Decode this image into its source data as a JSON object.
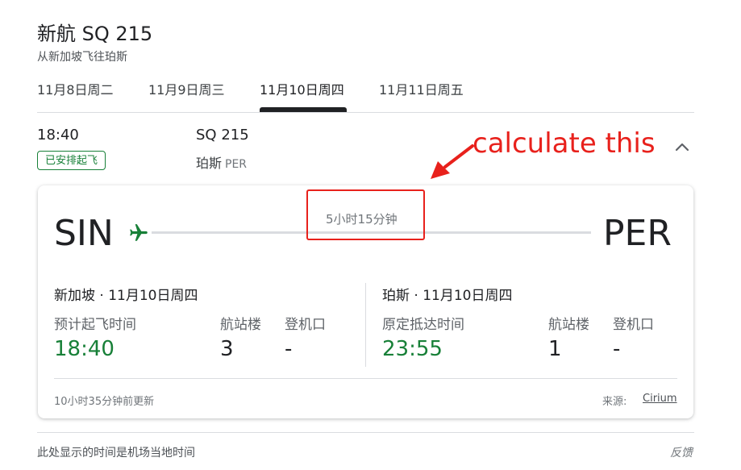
{
  "header": {
    "title": "新航 SQ 215",
    "subtitle": "从新加坡飞往珀斯"
  },
  "tabs": [
    {
      "label": "11月8日周二"
    },
    {
      "label": "11月9日周三"
    },
    {
      "label": "11月10日周四",
      "selected": true
    },
    {
      "label": "11月11日周五"
    }
  ],
  "summary": {
    "departure_time": "18:40",
    "status": "已安排起飞",
    "flight_number": "SQ 215",
    "destination_name": "珀斯",
    "destination_code": "PER"
  },
  "annotation": {
    "text": "calculate this",
    "color": "#e8211c"
  },
  "card": {
    "origin_code": "SIN",
    "dest_code": "PER",
    "duration": "5小时15分钟",
    "departure": {
      "place_date": "新加坡 · 11月10日周四",
      "time_label": "预计起飞时间",
      "time": "18:40",
      "terminal_label": "航站楼",
      "terminal": "3",
      "gate_label": "登机口",
      "gate": "-"
    },
    "arrival": {
      "place_date": "珀斯 · 11月10日周四",
      "time_label": "原定抵达时间",
      "time": "23:55",
      "terminal_label": "航站楼",
      "terminal": "1",
      "gate_label": "登机口",
      "gate": "-"
    },
    "updated": "10小时35分钟前更新",
    "source_label": "来源:",
    "source_name": "Cirium"
  },
  "footer": {
    "note": "此处显示的时间是机场当地时间",
    "feedback": "反馈"
  },
  "colors": {
    "accent_green": "#188038",
    "annotation_red": "#e8211c"
  },
  "icons": {
    "plane": "airplane-icon",
    "collapse": "chevron-up-icon"
  }
}
